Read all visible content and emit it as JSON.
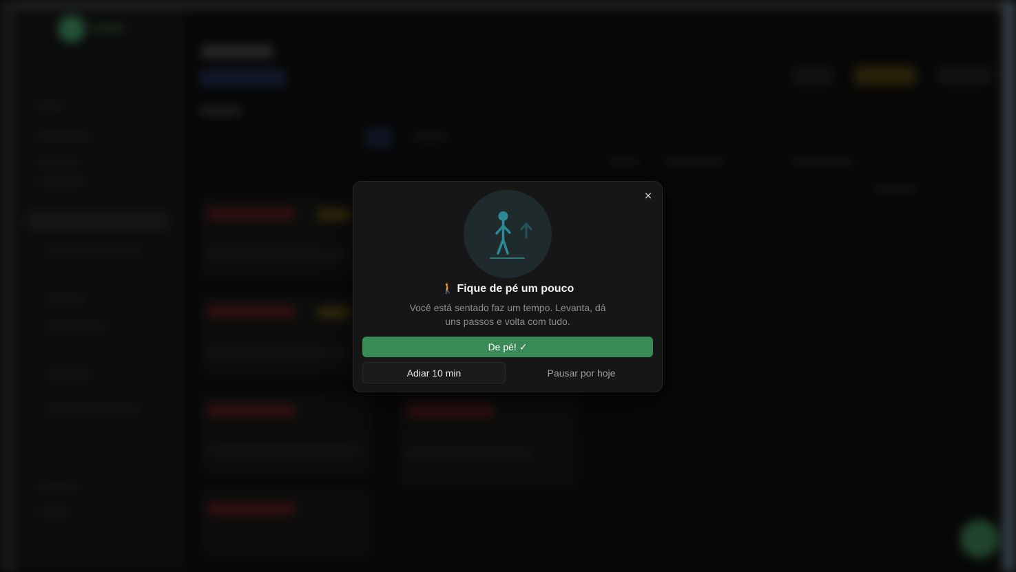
{
  "modal": {
    "close_label": "×",
    "title_emoji": "🚶",
    "title": "Fique de pé um pouco",
    "description": "Você está sentado faz um tempo. Levanta, dá uns passos e volta com tudo.",
    "primary_button": "De pé! ✓",
    "snooze_button": "Adiar 10 min",
    "pause_button": "Pausar por hoje",
    "illustration_icon": "standing-person-arrow-up-icon"
  },
  "colors": {
    "primary": "#3a8a58",
    "modal_background": "#161616",
    "illustration_background": "#1e2a2c",
    "illustration_figure": "#2e8896"
  }
}
